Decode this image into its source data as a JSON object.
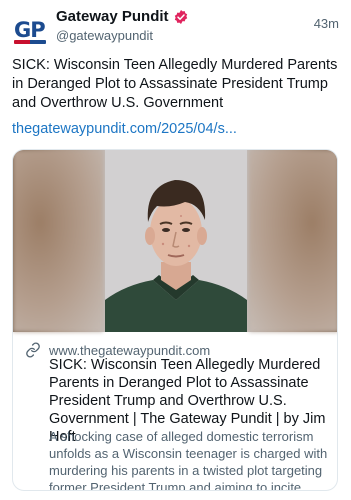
{
  "author": {
    "display_name": "Gateway Pundit",
    "handle": "@gatewaypundit",
    "avatar_text": "GP",
    "verified_color": "#e0245e"
  },
  "post": {
    "time": "43m",
    "text": "SICK: Wisconsin Teen Allegedly Murdered Parents in Deranged Plot to Assassinate President Trump and Overthrow U.S. Government",
    "link_text": "thegatewaypundit.com/2025/04/s..."
  },
  "card": {
    "domain": "www.thegatewaypundit.com",
    "title": "SICK: Wisconsin Teen Allegedly Murdered Parents in Deranged Plot to Assassinate President Trump and Overthrow U.S. Government | The Gateway Pundit | by Jim Hoft",
    "description": "A shocking case of alleged domestic terrorism unfolds as a Wisconsin teenager is charged with murdering his parents in a twisted plot targeting former President Trump and aiming to incite national chaos."
  },
  "colors": {
    "link": "#1d76c4",
    "muted": "#536471",
    "text": "#0f1419"
  },
  "icons": {
    "verified": "verified-badge-icon",
    "link": "link-icon"
  }
}
